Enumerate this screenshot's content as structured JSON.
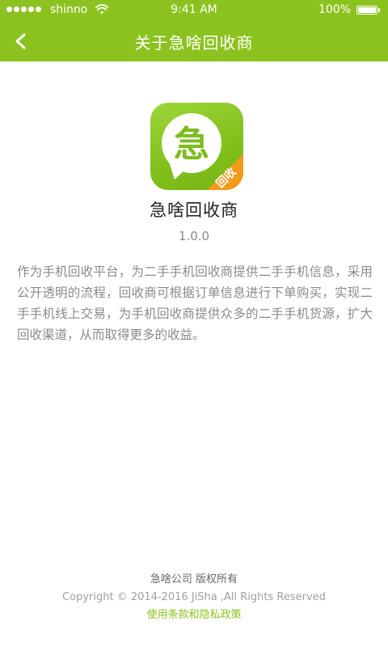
{
  "status_bar": {
    "carrier": "shinno",
    "time": "9:41 AM",
    "battery": "100%",
    "battery_level": 1.0,
    "icons": [
      "signal-icon",
      "wifi-icon",
      "battery-icon"
    ]
  },
  "nav": {
    "title": "关于急啥回收商",
    "back_icon": "back-chevron-icon"
  },
  "app": {
    "icon_glyph": "急",
    "icon_badge": "回收",
    "name": "急啥回收商",
    "version": "1.0.0"
  },
  "description": "作为手机回收平台，为二手手机回收商提供二手手机信息，采用公开透明的流程，回收商可根据订单信息进行下单购买，实现二手手机线上交易，为手机回收商提供众多的二手手机货源，扩大回收渠道，从而取得更多的收益。",
  "footer": {
    "company": "急啥公司 版权所有",
    "copyright": "Copyright © 2014-2016 JiSha ,All Rights Reserved",
    "terms_link": "使用条款和隐私政策"
  },
  "colors": {
    "brand_green": "#8cc21f",
    "badge_orange": "#f29a1c",
    "text_dark": "#222222",
    "text_gray": "#8a8a8a"
  }
}
